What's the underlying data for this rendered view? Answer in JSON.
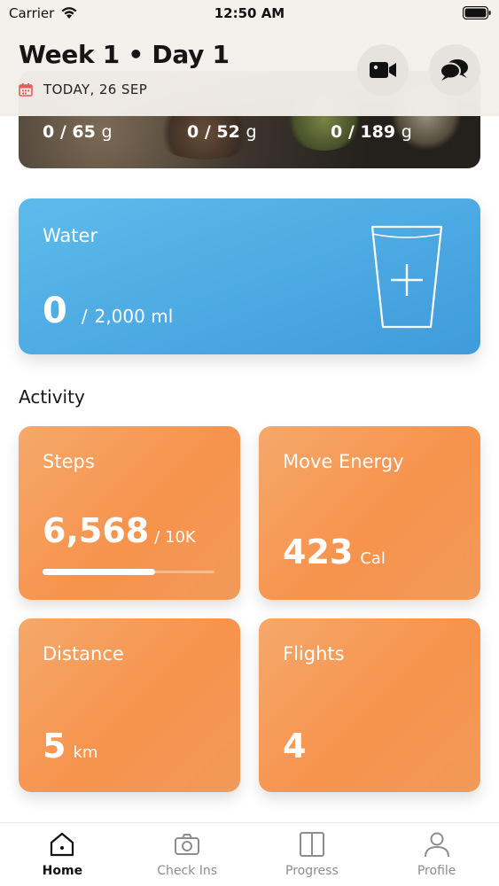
{
  "status_bar": {
    "carrier": "Carrier",
    "time": "12:50 AM"
  },
  "header": {
    "title": "Week 1 • Day 1",
    "date": "TODAY, 26 SEP"
  },
  "macros": [
    {
      "value": "0 / 65",
      "unit": "g"
    },
    {
      "value": "0 / 52",
      "unit": "g"
    },
    {
      "value": "0 / 189",
      "unit": "g"
    }
  ],
  "water": {
    "title": "Water",
    "current": "0",
    "separator": "/",
    "goal": "2,000 ml"
  },
  "activity": {
    "title": "Activity",
    "steps": {
      "label": "Steps",
      "value": "6,568",
      "unit": "/ 10K",
      "progress": 0.657
    },
    "move_energy": {
      "label": "Move Energy",
      "value": "423",
      "unit": "Cal"
    },
    "distance": {
      "label": "Distance",
      "value": "5",
      "unit": "km"
    },
    "flights": {
      "label": "Flights",
      "value": "4"
    }
  },
  "tabs": [
    {
      "label": "Home",
      "icon": "home-icon",
      "active": true
    },
    {
      "label": "Check Ins",
      "icon": "camera-icon",
      "active": false
    },
    {
      "label": "Progress",
      "icon": "progress-book-icon",
      "active": false
    },
    {
      "label": "Profile",
      "icon": "profile-icon",
      "active": false
    }
  ],
  "colors": {
    "water_card": "#4aa9e2",
    "activity_card": "#f69c5a",
    "calendar_icon": "#e25d5d"
  }
}
